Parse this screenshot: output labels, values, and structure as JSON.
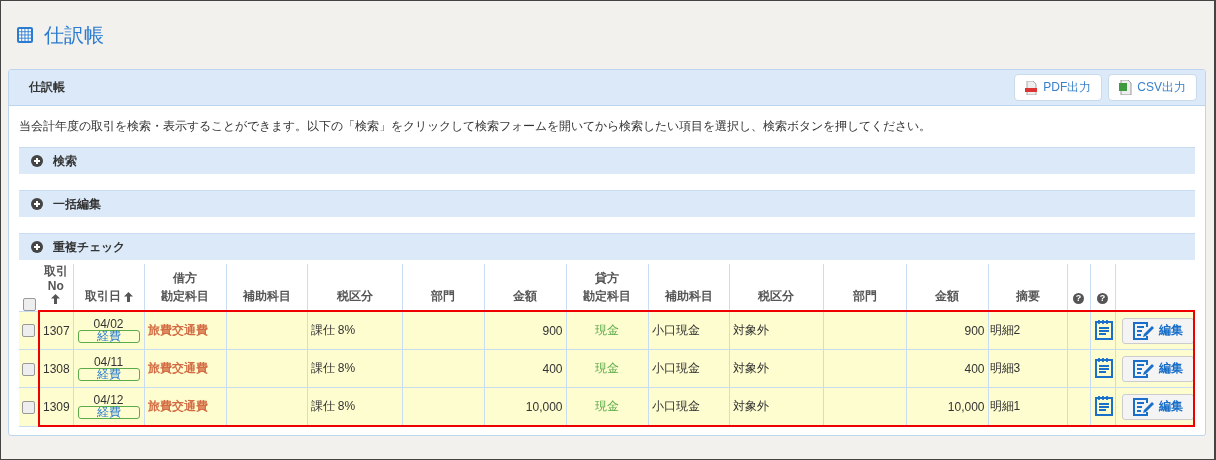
{
  "page_title": "仕訳帳",
  "panel": {
    "title": "仕訳帳",
    "buttons": [
      {
        "kind": "pdf",
        "label": "PDF出力"
      },
      {
        "kind": "csv",
        "label": "CSV出力"
      }
    ],
    "description": "当会計年度の取引を検索・表示することができます。以下の「検索」をクリックして検索フォームを開いてから検索したい項目を選択し、検索ボタンを押してください。",
    "sections": [
      {
        "label": "検索",
        "expanded": false
      },
      {
        "label": "一括編集",
        "expanded": false
      },
      {
        "label": "重複チェック",
        "expanded": false
      }
    ]
  },
  "table": {
    "select_all": {
      "checked": false
    },
    "columns": [
      {
        "kind": "text",
        "label": "取引",
        "label2": "No",
        "sort": true
      },
      {
        "kind": "text",
        "label": "取引日",
        "sort": true
      },
      {
        "kind": "text",
        "group": "借方",
        "label": "勘定科目"
      },
      {
        "kind": "text",
        "label": "補助科目"
      },
      {
        "kind": "text",
        "label": "税区分"
      },
      {
        "kind": "text",
        "label": "部門"
      },
      {
        "kind": "text",
        "label": "金額"
      },
      {
        "kind": "text",
        "group": "貸方",
        "label": "勘定科目"
      },
      {
        "kind": "text",
        "label": "補助科目"
      },
      {
        "kind": "text",
        "label": "税区分"
      },
      {
        "kind": "text",
        "label": "部門"
      },
      {
        "kind": "text",
        "label": "金額"
      },
      {
        "kind": "text",
        "label": "摘要"
      },
      {
        "kind": "help",
        "label": "?"
      },
      {
        "kind": "help",
        "label": "?"
      }
    ],
    "rows": [
      {
        "checked": false,
        "highlighted": true,
        "no": "1307",
        "date": "04/02",
        "tag": "経費",
        "debit_account": "旅費交通費",
        "debit_sub": "",
        "debit_tax": "課仕 8%",
        "debit_dept": "",
        "debit_amount": "900",
        "credit_account": "現金",
        "credit_sub": "小口現金",
        "credit_tax": "対象外",
        "credit_dept": "",
        "credit_amount": "900",
        "memo": "明細2",
        "edit_label": "編集"
      },
      {
        "checked": false,
        "highlighted": true,
        "no": "1308",
        "date": "04/11",
        "tag": "経費",
        "debit_account": "旅費交通費",
        "debit_sub": "",
        "debit_tax": "課仕 8%",
        "debit_dept": "",
        "debit_amount": "400",
        "credit_account": "現金",
        "credit_sub": "小口現金",
        "credit_tax": "対象外",
        "credit_dept": "",
        "credit_amount": "400",
        "memo": "明細3",
        "edit_label": "編集"
      },
      {
        "checked": false,
        "highlighted": true,
        "no": "1309",
        "date": "04/12",
        "tag": "経費",
        "debit_account": "旅費交通費",
        "debit_sub": "",
        "debit_tax": "課仕 8%",
        "debit_dept": "",
        "debit_amount": "10,000",
        "credit_account": "現金",
        "credit_sub": "小口現金",
        "credit_tax": "対象外",
        "credit_dept": "",
        "credit_amount": "10,000",
        "memo": "明細1",
        "edit_label": "編集"
      }
    ]
  }
}
